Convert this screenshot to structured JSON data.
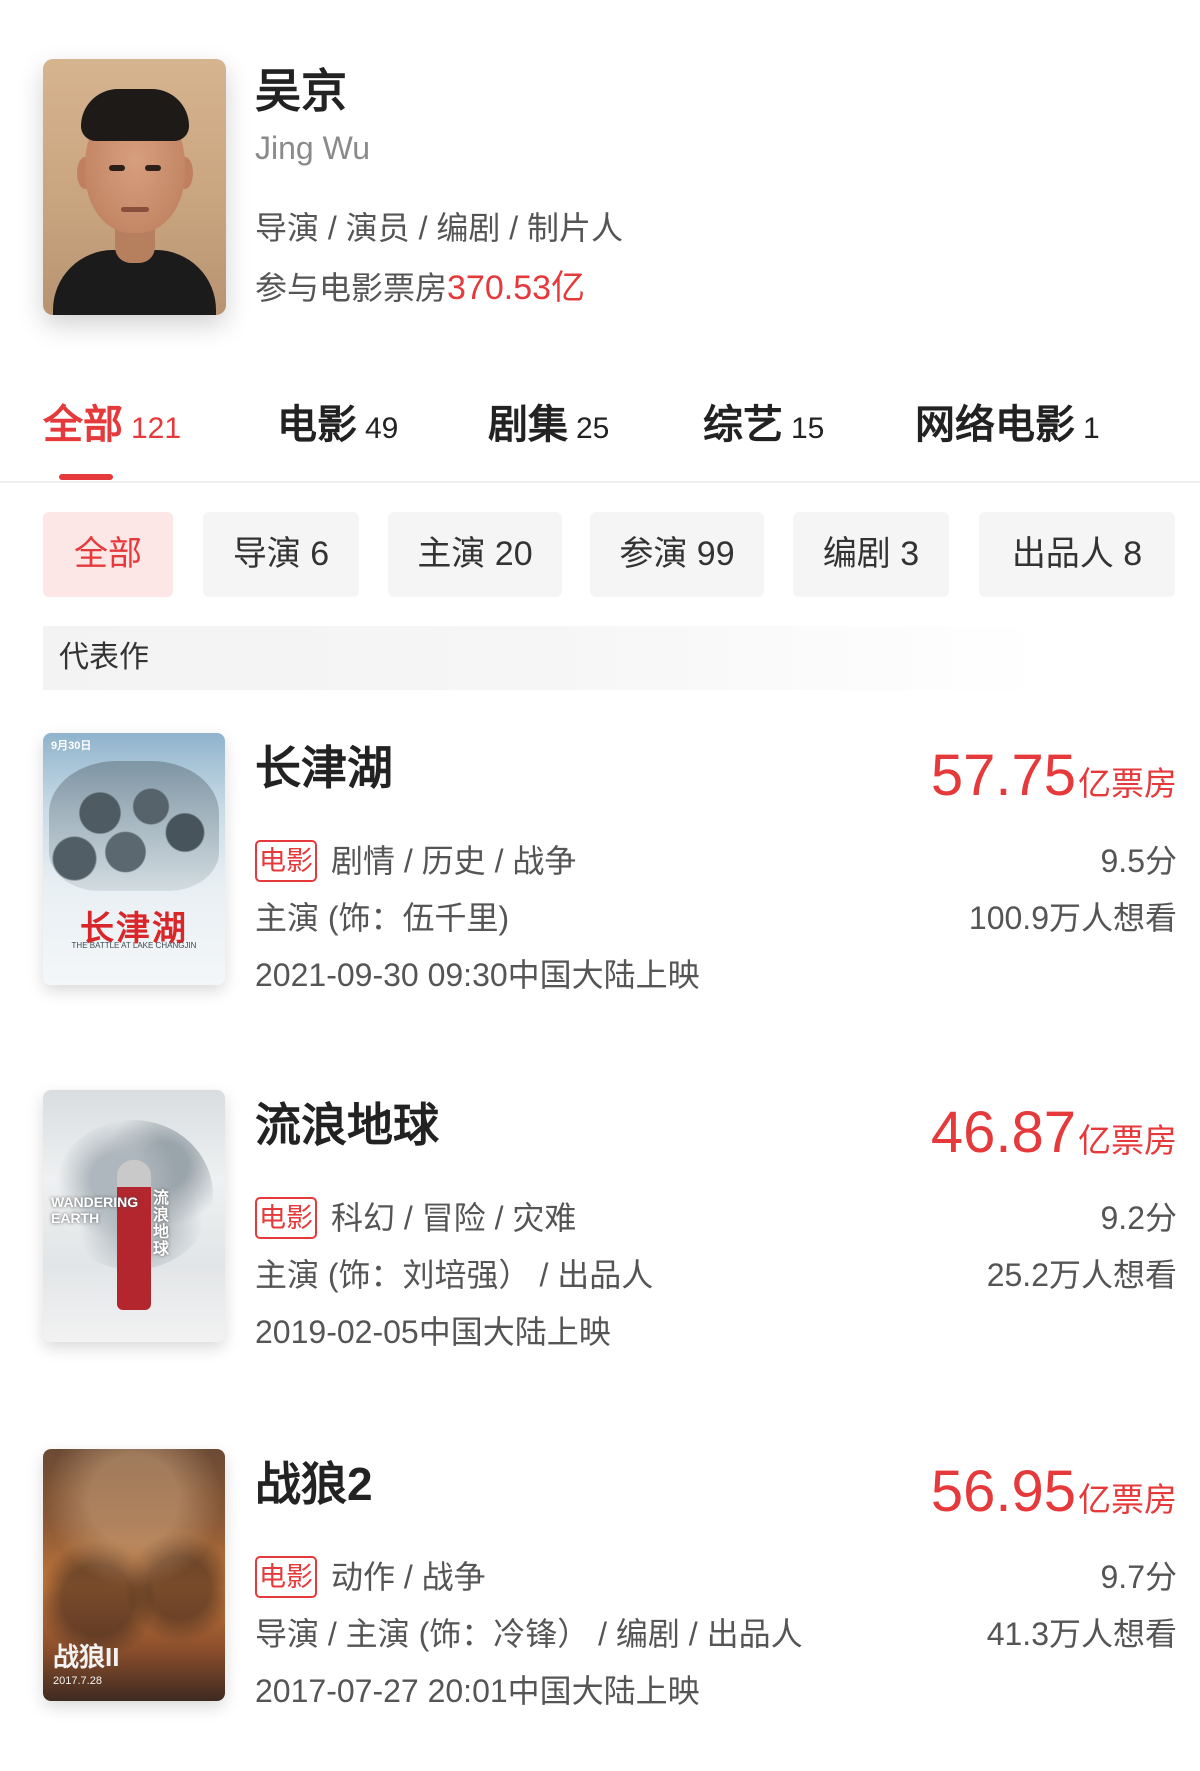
{
  "colors": {
    "accent": "#e5393b",
    "chip_active_bg": "#fde6e6",
    "chip_bg": "#f5f5f5",
    "text_primary": "#222222",
    "text_secondary": "#555555"
  },
  "person": {
    "name": "吴京",
    "name_en": "Jing Wu",
    "roles": "导演 / 演员 / 编剧 / 制片人",
    "box_office_prefix": "参与电影票房",
    "box_office_value": "370.53亿",
    "avatar_icon": "person-photo"
  },
  "tabs": [
    {
      "label": "全部",
      "count": "121",
      "active": true
    },
    {
      "label": "电影",
      "count": "49",
      "active": false
    },
    {
      "label": "剧集",
      "count": "25",
      "active": false
    },
    {
      "label": "综艺",
      "count": "15",
      "active": false
    },
    {
      "label": "网络电影",
      "count": "1",
      "active": false
    }
  ],
  "filters": [
    {
      "label": "全部",
      "active": true
    },
    {
      "label": "导演 6",
      "active": false
    },
    {
      "label": "主演 20",
      "active": false
    },
    {
      "label": "参演 99",
      "active": false
    },
    {
      "label": "编剧 3",
      "active": false
    },
    {
      "label": "出品人 8",
      "active": false
    }
  ],
  "section_title": "代表作",
  "movies": [
    {
      "title": "长津湖",
      "box_office": "57.75",
      "box_office_unit": "亿票房",
      "tag": "电影",
      "genres": "剧情 / 历史 / 战争",
      "role": "主演 (饰：伍千里)",
      "release": "2021-09-30 09:30中国大陆上映",
      "score": "9.5分",
      "want": "100.9万人想看",
      "poster": {
        "top_text": "9月30日",
        "title": "长津湖",
        "subtitle": "THE BATTLE AT LAKE CHANGJIN"
      }
    },
    {
      "title": "流浪地球",
      "box_office": "46.87",
      "box_office_unit": "亿票房",
      "tag": "电影",
      "genres": "科幻 / 冒险 / 灾难",
      "role": "主演 (饰：刘培强）  / 出品人",
      "release": "2019-02-05中国大陆上映",
      "score": "9.2分",
      "want": "25.2万人想看",
      "poster": {
        "title": "WANDERING EARTH",
        "title_cn": "流浪地球"
      }
    },
    {
      "title": "战狼2",
      "box_office": "56.95",
      "box_office_unit": "亿票房",
      "tag": "电影",
      "genres": "动作 / 战争",
      "role": "导演 / 主演 (饰：冷锋）  / 编剧 / 出品人",
      "release": "2017-07-27 20:01中国大陆上映",
      "score": "9.7分",
      "want": "41.3万人想看",
      "poster": {
        "title": "战狼II",
        "date": "2017.7.28"
      }
    }
  ]
}
